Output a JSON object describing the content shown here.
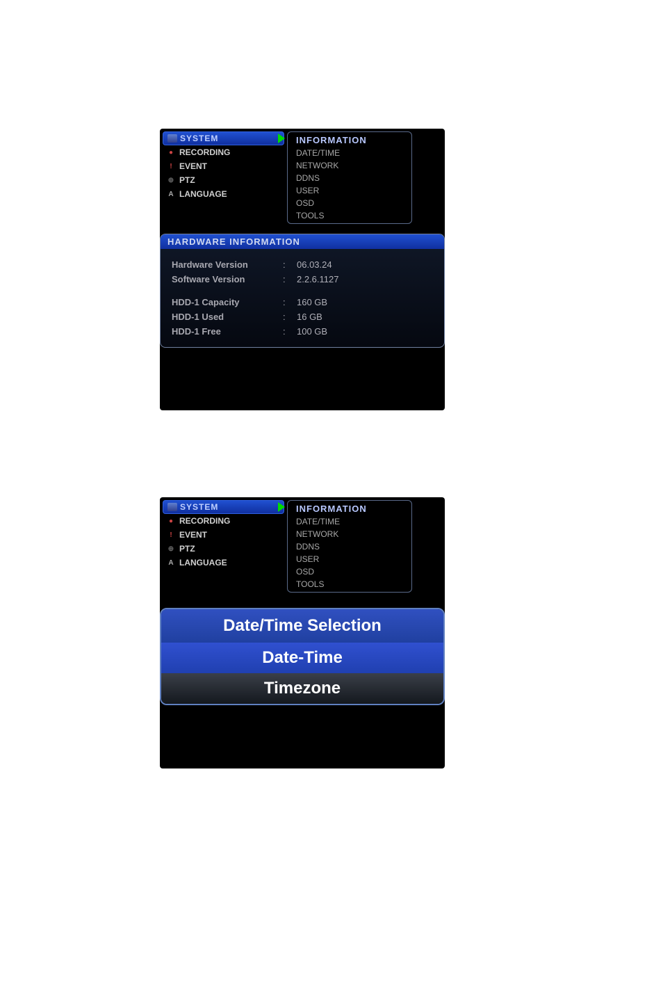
{
  "menu": {
    "system_label": "SYSTEM",
    "items": [
      {
        "label": "RECORDING"
      },
      {
        "label": "EVENT"
      },
      {
        "label": "PTZ"
      },
      {
        "label": "LANGUAGE"
      }
    ]
  },
  "submenu": {
    "header": "INFORMATION",
    "items": [
      {
        "label": "DATE/TIME"
      },
      {
        "label": "NETWORK"
      },
      {
        "label": "DDNS"
      },
      {
        "label": "USER"
      },
      {
        "label": "OSD"
      },
      {
        "label": "TOOLS"
      }
    ]
  },
  "hardware": {
    "header": "HARDWARE INFORMATION",
    "rows": [
      {
        "label": "Hardware Version",
        "value": "06.03.24"
      },
      {
        "label": "Software Version",
        "value": "2.2.6.1127"
      },
      {
        "label": "HDD-1 Capacity",
        "value": "160 GB"
      },
      {
        "label": "HDD-1 Used",
        "value": "16 GB"
      },
      {
        "label": "HDD-1 Free",
        "value": "100 GB"
      }
    ]
  },
  "datetime": {
    "header": "Date/Time Selection",
    "item_active": "Date-Time",
    "item_inactive": "Timezone"
  }
}
